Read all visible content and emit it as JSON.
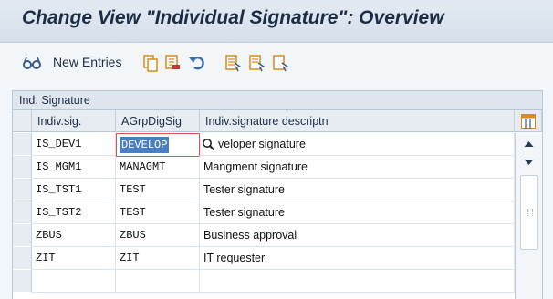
{
  "header": {
    "title": "Change View \"Individual Signature\": Overview"
  },
  "toolbar": {
    "new_entries_label": "New Entries",
    "icons": [
      "glasses-icon",
      "copy-icon",
      "delete-icon",
      "undo-icon",
      "select-all-icon",
      "select-block-icon",
      "deselect-icon"
    ]
  },
  "panel": {
    "title": "Ind. Signature"
  },
  "table": {
    "columns": [
      "Indiv.sig.",
      "AGrpDigSig",
      "Indiv.signature descriptn"
    ],
    "rows": [
      {
        "sig": "IS_DEV1",
        "grp": "DEVELOP",
        "desc": "veloper signature"
      },
      {
        "sig": "IS_MGM1",
        "grp": "MANAGMT",
        "desc": "Mangment signature"
      },
      {
        "sig": "IS_TST1",
        "grp": "TEST",
        "desc": "Tester signature"
      },
      {
        "sig": "IS_TST2",
        "grp": "TEST",
        "desc": "Tester signature"
      },
      {
        "sig": "ZBUS",
        "grp": "ZBUS",
        "desc": "Business approval"
      },
      {
        "sig": "ZIT",
        "grp": "ZIT",
        "desc": "IT  requester"
      }
    ]
  },
  "colors": {
    "accent": "#4a7fc6",
    "title": "#1c2d45",
    "focus_border": "#e05050"
  }
}
